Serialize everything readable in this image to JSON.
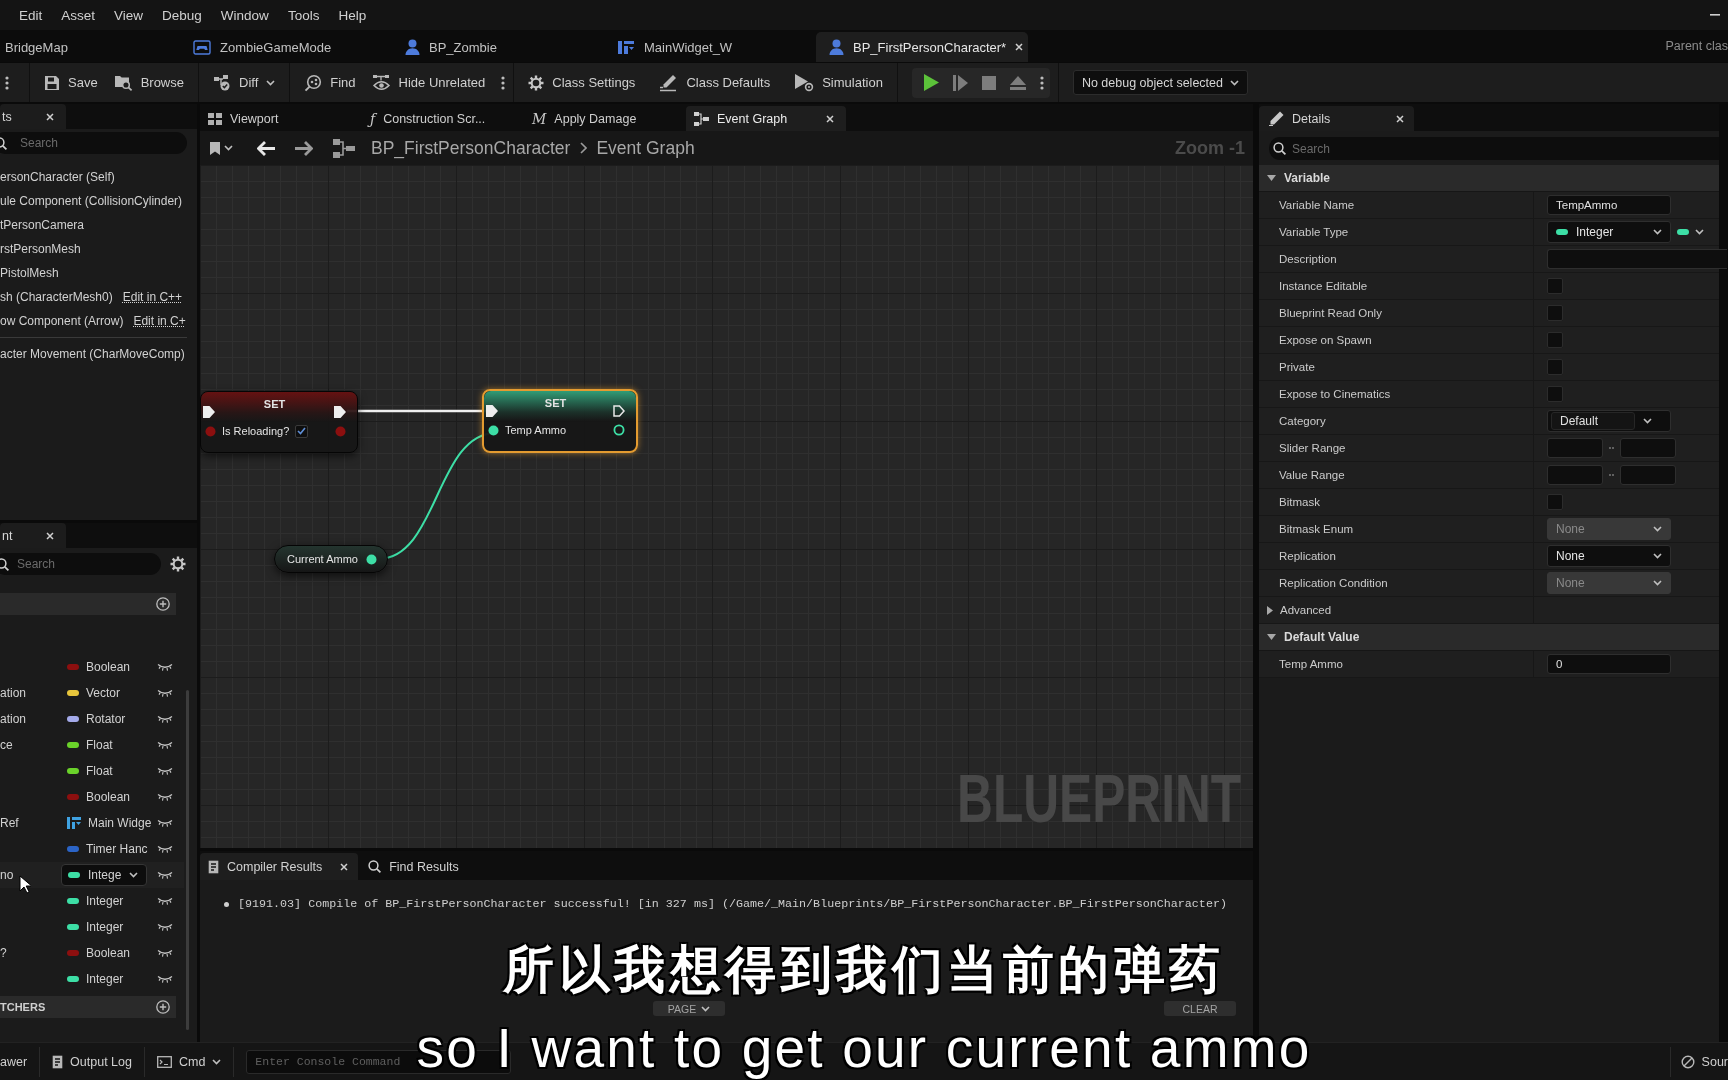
{
  "menu_bar": {
    "items": [
      "Edit",
      "Asset",
      "View",
      "Debug",
      "Window",
      "Tools",
      "Help"
    ]
  },
  "asset_tabs": {
    "tabs": [
      {
        "label": "BridgeMap",
        "kind": "level",
        "selected": false
      },
      {
        "label": "ZombieGameMode",
        "kind": "game_mode",
        "selected": false
      },
      {
        "label": "BP_Zombie",
        "kind": "character",
        "selected": false
      },
      {
        "label": "MainWidget_W",
        "kind": "widget",
        "selected": false
      },
      {
        "label": "BP_FirstPersonCharacter*",
        "kind": "character",
        "selected": true
      }
    ],
    "parent_class": "Parent clas"
  },
  "toolbar": {
    "groups": [
      {
        "items": [
          {
            "label": "Save",
            "kind": "save"
          },
          {
            "label": "Browse",
            "kind": "browse"
          }
        ]
      },
      {
        "items": [
          {
            "label": "Diff",
            "kind": "diff",
            "dropdown": true
          }
        ]
      },
      {
        "items": [
          {
            "label": "Find",
            "kind": "find"
          },
          {
            "label": "Hide Unrelated",
            "kind": "hide_unrelated"
          }
        ],
        "overflow": true
      },
      {
        "items": [
          {
            "label": "Class Settings",
            "kind": "class_settings"
          },
          {
            "label": "Class Defaults",
            "kind": "class_defaults"
          },
          {
            "label": "Simulation",
            "kind": "simulation"
          }
        ]
      }
    ],
    "debug_object": "No debug object selected"
  },
  "components_panel": {
    "tab": "ts",
    "search": {
      "placeholder": "Search"
    },
    "items": [
      {
        "label": "ersonCharacter (Self)"
      },
      {
        "label": "ule Component (CollisionCylinder)"
      },
      {
        "label": "tPersonCamera"
      },
      {
        "label": "rstPersonMesh"
      },
      {
        "label": "PistolMesh"
      },
      {
        "label": "sh (CharacterMesh0)",
        "link": "Edit in C++"
      },
      {
        "label": "ow Component (Arrow)",
        "link": "Edit in C+"
      },
      {
        "label": "acter Movement (CharMoveComp)",
        "divider_before": true
      }
    ]
  },
  "my_blueprint_panel": {
    "tab": "nt",
    "search": {
      "placeholder": "Search"
    },
    "variables": [
      {
        "type": "Boolean",
        "kind": "dot",
        "color": "#8c0f0f",
        "selected": false
      },
      {
        "name": "ation",
        "type": "Vector",
        "kind": "dot",
        "color": "#e8c63c",
        "selected": false
      },
      {
        "name": "ation",
        "type": "Rotator",
        "kind": "dot",
        "color": "#a4aaea",
        "selected": false
      },
      {
        "name": "ce",
        "type": "Float",
        "kind": "dot",
        "color": "#6ad22a",
        "selected": false
      },
      {
        "type": "Float",
        "kind": "dot",
        "color": "#6ad22a",
        "selected": false
      },
      {
        "type": "Boolean",
        "kind": "dot",
        "color": "#8c0f0f",
        "selected": false
      },
      {
        "name": "Ref",
        "type": "Main Widge",
        "kind": "widget",
        "color": "#3fa2e2",
        "selected": false
      },
      {
        "type": "Timer Hanc",
        "kind": "dot",
        "color": "#2b64c6",
        "selected": false
      },
      {
        "name": "no",
        "type": "Intege",
        "kind": "dot",
        "color": "#3ddfa6",
        "selected": true
      },
      {
        "type": "Integer",
        "kind": "dot",
        "color": "#3ddfa6",
        "selected": false
      },
      {
        "type": "Integer",
        "kind": "dot",
        "color": "#3ddfa6",
        "selected": false
      },
      {
        "name": "?",
        "type": "Boolean",
        "kind": "dot",
        "color": "#8c0f0f",
        "selected": false
      },
      {
        "type": "Integer",
        "kind": "dot",
        "color": "#3ddfa6",
        "selected": false
      }
    ],
    "dispatchers_header": "TCHERS"
  },
  "graph_tabs": [
    {
      "label": "Viewport",
      "kind": "viewport",
      "selected": false
    },
    {
      "label": "Construction Scr...",
      "kind": "glyph",
      "glyph": "ƒ",
      "selected": false
    },
    {
      "label": "Apply Damage",
      "kind": "glyph",
      "glyph": "M",
      "selected": false
    },
    {
      "label": "Event Graph",
      "kind": "graph",
      "selected": true
    }
  ],
  "breadcrumb": {
    "blueprint": "BP_FirstPersonCharacter",
    "graph": "Event Graph",
    "zoom": "Zoom -1"
  },
  "graph": {
    "nodes": [
      {
        "kind": "set",
        "title": "SET",
        "selected": false,
        "pin": {
          "label": "Is Reloading?",
          "color": "#8c0f0f",
          "checked": true
        }
      },
      {
        "kind": "set",
        "title": "SET",
        "selected": true,
        "pin": {
          "label": "Temp Ammo",
          "color": "#3ddfa6"
        }
      },
      {
        "kind": "get",
        "label": "Current Ammo",
        "color": "#3ddfa6",
        "selected": false
      }
    ],
    "watermark": "BLUEPRINT"
  },
  "compiler_results": {
    "tabs": [
      {
        "label": "Compiler Results",
        "kind": "compiler",
        "selected": true
      },
      {
        "label": "Find Results",
        "kind": "find",
        "selected": false
      }
    ],
    "messages": [
      "[9191.03] Compile of BP_FirstPersonCharacter successful! [in 327 ms] (/Game/_Main/Blueprints/BP_FirstPersonCharacter.BP_FirstPersonCharacter)"
    ],
    "buttons": [
      {
        "label": "PAGE",
        "dropdown": true
      },
      {
        "label": "CLEAR"
      }
    ]
  },
  "details": {
    "tab": "Details",
    "search": {
      "placeholder": "Search"
    },
    "sections": [
      {
        "title": "Variable",
        "expanded": true,
        "rows": [
          {
            "label": "Variable Name",
            "kind": "text",
            "value": "TempAmmo"
          },
          {
            "label": "Variable Type",
            "kind": "type",
            "value": "Integer",
            "color": "#3ddfa6"
          },
          {
            "label": "Description",
            "kind": "long_text"
          },
          {
            "label": "Instance Editable",
            "kind": "checkbox",
            "checked": false
          },
          {
            "label": "Blueprint Read Only",
            "kind": "checkbox",
            "checked": false
          },
          {
            "label": "Expose on Spawn",
            "kind": "checkbox",
            "checked": false
          },
          {
            "label": "Private",
            "kind": "checkbox",
            "checked": false
          },
          {
            "label": "Expose to Cinematics",
            "kind": "checkbox",
            "checked": false
          },
          {
            "label": "Category",
            "kind": "combo",
            "value": "Default"
          },
          {
            "label": "Slider Range",
            "kind": "range"
          },
          {
            "label": "Value Range",
            "kind": "range"
          },
          {
            "label": "Bitmask",
            "kind": "checkbox",
            "checked": false
          },
          {
            "label": "Bitmask Enum",
            "kind": "dropdown",
            "value": "None",
            "disabled": true
          },
          {
            "label": "Replication",
            "kind": "dropdown",
            "value": "None",
            "disabled": false
          },
          {
            "label": "Replication Condition",
            "kind": "dropdown",
            "value": "None",
            "disabled": true
          },
          {
            "label": "Advanced",
            "kind": "expander",
            "expanded": false
          }
        ]
      },
      {
        "title": "Default Value",
        "expanded": true,
        "rows": [
          {
            "label": "Temp Ammo",
            "kind": "text",
            "value": "0"
          }
        ]
      }
    ]
  },
  "status_bar": {
    "left": [
      {
        "label": "awer",
        "kind": "drawer"
      },
      {
        "label": "Output Log",
        "kind": "log"
      },
      {
        "label": "Cmd",
        "kind": "cmd",
        "dropdown": true
      }
    ],
    "console": {
      "placeholder": "Enter Console Command"
    },
    "right": [
      {
        "label": "Sour",
        "kind": "source"
      }
    ]
  },
  "subtitles": [
    "所以我想得到我们当前的弹药",
    "so I want to get our current ammo"
  ]
}
